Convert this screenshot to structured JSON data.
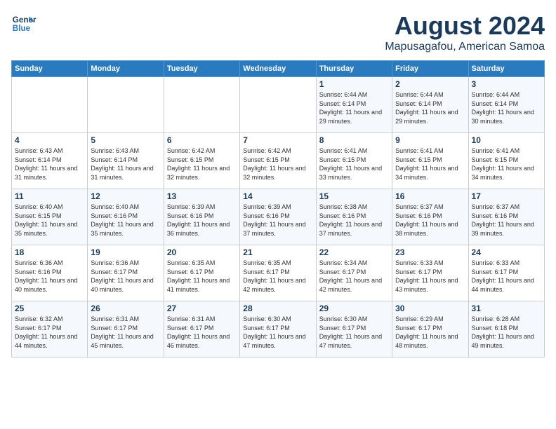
{
  "header": {
    "logo_line1": "General",
    "logo_line2": "Blue",
    "month": "August 2024",
    "location": "Mapusagafou, American Samoa"
  },
  "weekdays": [
    "Sunday",
    "Monday",
    "Tuesday",
    "Wednesday",
    "Thursday",
    "Friday",
    "Saturday"
  ],
  "weeks": [
    [
      {
        "day": "",
        "info": ""
      },
      {
        "day": "",
        "info": ""
      },
      {
        "day": "",
        "info": ""
      },
      {
        "day": "",
        "info": ""
      },
      {
        "day": "1",
        "info": "Sunrise: 6:44 AM\nSunset: 6:14 PM\nDaylight: 11 hours and 29 minutes."
      },
      {
        "day": "2",
        "info": "Sunrise: 6:44 AM\nSunset: 6:14 PM\nDaylight: 11 hours and 29 minutes."
      },
      {
        "day": "3",
        "info": "Sunrise: 6:44 AM\nSunset: 6:14 PM\nDaylight: 11 hours and 30 minutes."
      }
    ],
    [
      {
        "day": "4",
        "info": "Sunrise: 6:43 AM\nSunset: 6:14 PM\nDaylight: 11 hours and 31 minutes."
      },
      {
        "day": "5",
        "info": "Sunrise: 6:43 AM\nSunset: 6:14 PM\nDaylight: 11 hours and 31 minutes."
      },
      {
        "day": "6",
        "info": "Sunrise: 6:42 AM\nSunset: 6:15 PM\nDaylight: 11 hours and 32 minutes."
      },
      {
        "day": "7",
        "info": "Sunrise: 6:42 AM\nSunset: 6:15 PM\nDaylight: 11 hours and 32 minutes."
      },
      {
        "day": "8",
        "info": "Sunrise: 6:41 AM\nSunset: 6:15 PM\nDaylight: 11 hours and 33 minutes."
      },
      {
        "day": "9",
        "info": "Sunrise: 6:41 AM\nSunset: 6:15 PM\nDaylight: 11 hours and 34 minutes."
      },
      {
        "day": "10",
        "info": "Sunrise: 6:41 AM\nSunset: 6:15 PM\nDaylight: 11 hours and 34 minutes."
      }
    ],
    [
      {
        "day": "11",
        "info": "Sunrise: 6:40 AM\nSunset: 6:15 PM\nDaylight: 11 hours and 35 minutes."
      },
      {
        "day": "12",
        "info": "Sunrise: 6:40 AM\nSunset: 6:16 PM\nDaylight: 11 hours and 35 minutes."
      },
      {
        "day": "13",
        "info": "Sunrise: 6:39 AM\nSunset: 6:16 PM\nDaylight: 11 hours and 36 minutes."
      },
      {
        "day": "14",
        "info": "Sunrise: 6:39 AM\nSunset: 6:16 PM\nDaylight: 11 hours and 37 minutes."
      },
      {
        "day": "15",
        "info": "Sunrise: 6:38 AM\nSunset: 6:16 PM\nDaylight: 11 hours and 37 minutes."
      },
      {
        "day": "16",
        "info": "Sunrise: 6:37 AM\nSunset: 6:16 PM\nDaylight: 11 hours and 38 minutes."
      },
      {
        "day": "17",
        "info": "Sunrise: 6:37 AM\nSunset: 6:16 PM\nDaylight: 11 hours and 39 minutes."
      }
    ],
    [
      {
        "day": "18",
        "info": "Sunrise: 6:36 AM\nSunset: 6:16 PM\nDaylight: 11 hours and 40 minutes."
      },
      {
        "day": "19",
        "info": "Sunrise: 6:36 AM\nSunset: 6:17 PM\nDaylight: 11 hours and 40 minutes."
      },
      {
        "day": "20",
        "info": "Sunrise: 6:35 AM\nSunset: 6:17 PM\nDaylight: 11 hours and 41 minutes."
      },
      {
        "day": "21",
        "info": "Sunrise: 6:35 AM\nSunset: 6:17 PM\nDaylight: 11 hours and 42 minutes."
      },
      {
        "day": "22",
        "info": "Sunrise: 6:34 AM\nSunset: 6:17 PM\nDaylight: 11 hours and 42 minutes."
      },
      {
        "day": "23",
        "info": "Sunrise: 6:33 AM\nSunset: 6:17 PM\nDaylight: 11 hours and 43 minutes."
      },
      {
        "day": "24",
        "info": "Sunrise: 6:33 AM\nSunset: 6:17 PM\nDaylight: 11 hours and 44 minutes."
      }
    ],
    [
      {
        "day": "25",
        "info": "Sunrise: 6:32 AM\nSunset: 6:17 PM\nDaylight: 11 hours and 44 minutes."
      },
      {
        "day": "26",
        "info": "Sunrise: 6:31 AM\nSunset: 6:17 PM\nDaylight: 11 hours and 45 minutes."
      },
      {
        "day": "27",
        "info": "Sunrise: 6:31 AM\nSunset: 6:17 PM\nDaylight: 11 hours and 46 minutes."
      },
      {
        "day": "28",
        "info": "Sunrise: 6:30 AM\nSunset: 6:17 PM\nDaylight: 11 hours and 47 minutes."
      },
      {
        "day": "29",
        "info": "Sunrise: 6:30 AM\nSunset: 6:17 PM\nDaylight: 11 hours and 47 minutes."
      },
      {
        "day": "30",
        "info": "Sunrise: 6:29 AM\nSunset: 6:17 PM\nDaylight: 11 hours and 48 minutes."
      },
      {
        "day": "31",
        "info": "Sunrise: 6:28 AM\nSunset: 6:18 PM\nDaylight: 11 hours and 49 minutes."
      }
    ]
  ]
}
